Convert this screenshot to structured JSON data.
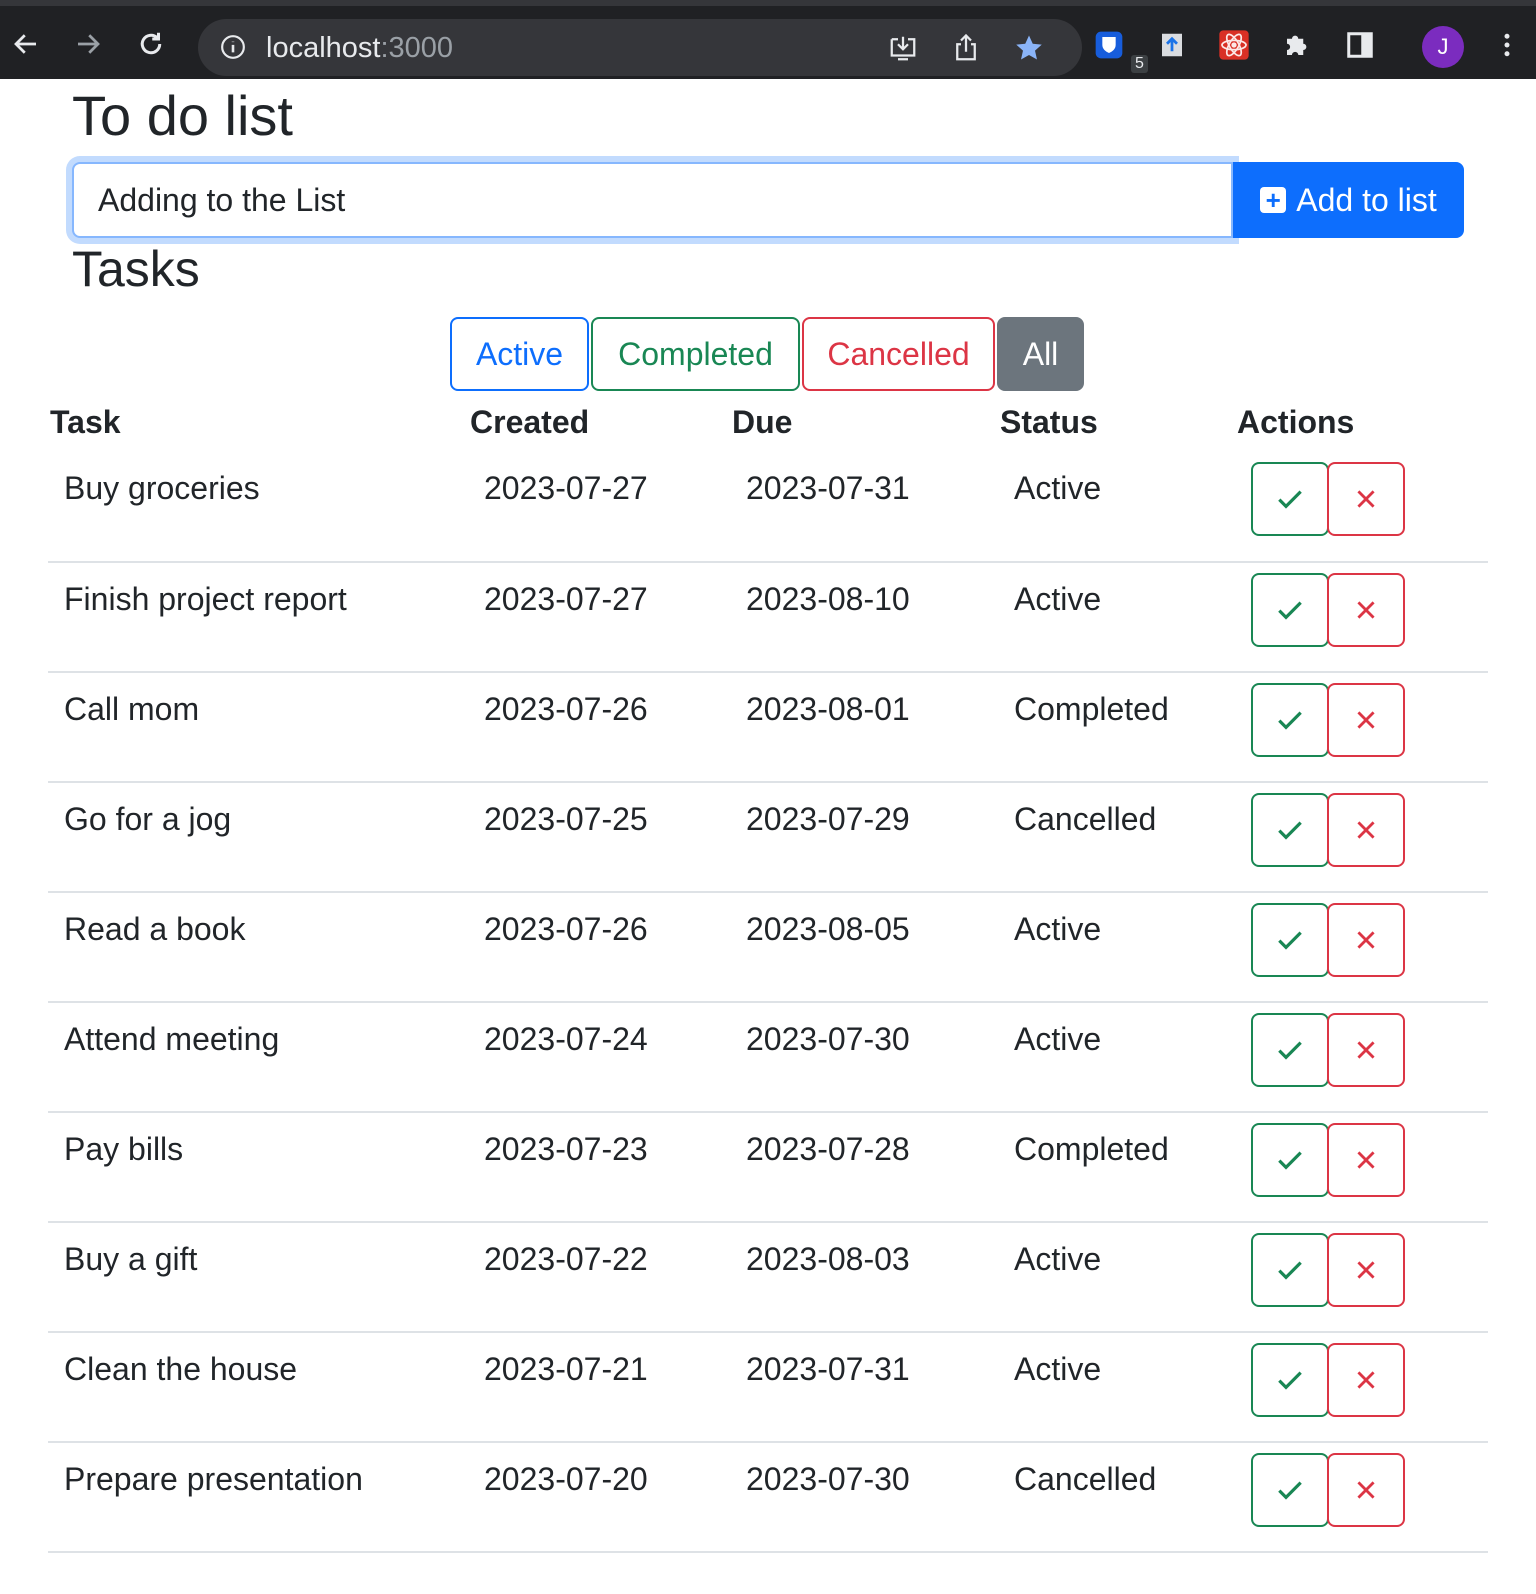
{
  "browser": {
    "url_host": "localhost",
    "url_port": ":3000",
    "extension_badge": "5",
    "avatar_letter": "J"
  },
  "page": {
    "title": "To do list",
    "input": {
      "value": "Adding to the List",
      "placeholder": ""
    },
    "add_button_label": "Add to list",
    "tasks_heading": "Tasks",
    "filters": [
      "Active",
      "Completed",
      "Cancelled",
      "All"
    ],
    "columns": [
      "Task",
      "Created",
      "Due",
      "Status",
      "Actions"
    ],
    "tasks": [
      {
        "task": "Buy groceries",
        "created": "2023-07-27",
        "due": "2023-07-31",
        "status": "Active"
      },
      {
        "task": "Finish project report",
        "created": "2023-07-27",
        "due": "2023-08-10",
        "status": "Active"
      },
      {
        "task": "Call mom",
        "created": "2023-07-26",
        "due": "2023-08-01",
        "status": "Completed"
      },
      {
        "task": "Go for a jog",
        "created": "2023-07-25",
        "due": "2023-07-29",
        "status": "Cancelled"
      },
      {
        "task": "Read a book",
        "created": "2023-07-26",
        "due": "2023-08-05",
        "status": "Active"
      },
      {
        "task": "Attend meeting",
        "created": "2023-07-24",
        "due": "2023-07-30",
        "status": "Active"
      },
      {
        "task": "Pay bills",
        "created": "2023-07-23",
        "due": "2023-07-28",
        "status": "Completed"
      },
      {
        "task": "Buy a gift",
        "created": "2023-07-22",
        "due": "2023-08-03",
        "status": "Active"
      },
      {
        "task": "Clean the house",
        "created": "2023-07-21",
        "due": "2023-07-31",
        "status": "Active"
      },
      {
        "task": "Prepare presentation",
        "created": "2023-07-20",
        "due": "2023-07-30",
        "status": "Cancelled"
      }
    ]
  },
  "icons": {
    "add": "plus-square-icon",
    "complete": "check-icon",
    "cancel": "x-icon"
  },
  "colors": {
    "primary": "#0d6efd",
    "success": "#198754",
    "danger": "#dc3545",
    "secondary": "#6c757d"
  }
}
